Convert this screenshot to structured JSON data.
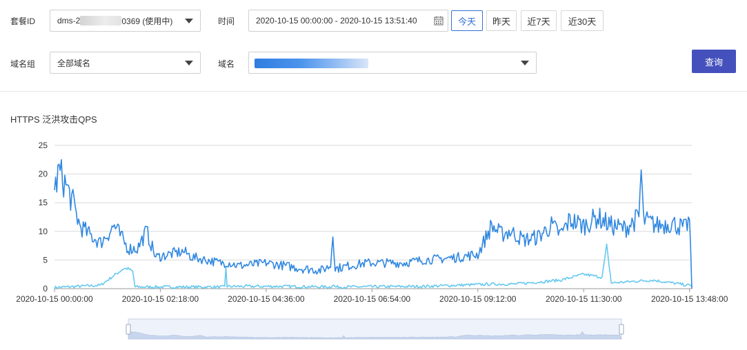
{
  "filters": {
    "package_label": "套餐ID",
    "package_value_prefix": "dms-2",
    "package_value_suffix": "0369 (使用中)",
    "time_label": "时间",
    "time_range": "2020-10-15 00:00:00 - 2020-10-15 13:51:40",
    "quick_buttons": [
      "今天",
      "昨天",
      "近7天",
      "近30天"
    ],
    "active_quick": "今天",
    "domain_group_label": "域名组",
    "domain_group_value": "全部域名",
    "domain_label": "域名",
    "query_button": "查询"
  },
  "colors": {
    "series_primary": "#2f87e0",
    "series_secondary": "#64c8f0",
    "query_button_bg": "#4451bd",
    "active_button": "#2f6fd6"
  },
  "chart_data": {
    "type": "line",
    "title": "HTTPS 泛洪攻击QPS",
    "xlabel": "",
    "ylabel": "",
    "ylim": [
      0,
      25
    ],
    "yticks": [
      0,
      5,
      10,
      15,
      20,
      25
    ],
    "x_ticks": [
      "2020-10-15 00:00:00",
      "2020-10-15 02:18:00",
      "2020-10-15 04:36:00",
      "2020-10-15 06:54:00",
      "2020-10-15 09:12:00",
      "2020-10-15 11:30:00",
      "2020-10-15 13:48:00"
    ],
    "x_unit": "hours since 2020-10-15 00:00:00",
    "grid": "horizontal",
    "series": [
      {
        "x": [
          0,
          0.1,
          0.25,
          0.4,
          0.55,
          0.75,
          1.0,
          1.3,
          1.6,
          1.8,
          2.0,
          2.2,
          2.5,
          2.8,
          3.0,
          3.3,
          3.6,
          3.8,
          4.0,
          4.3,
          4.6,
          5.0,
          5.4,
          5.8,
          6.0,
          6.05,
          6.1,
          6.4,
          6.8,
          7.2,
          7.6,
          8.0,
          8.4,
          8.8,
          9.2,
          9.5,
          9.7,
          9.9,
          10.2,
          10.5,
          10.8,
          11.0,
          11.2,
          11.5,
          11.8,
          12.1,
          12.4,
          12.7,
          12.75,
          12.8,
          13.1,
          13.4,
          13.7,
          13.8,
          13.85
        ],
        "values": [
          17,
          20.5,
          18,
          15,
          11,
          9.5,
          8,
          11,
          7,
          7,
          10,
          5.5,
          6,
          6.5,
          5.5,
          5,
          4.5,
          4.5,
          4,
          4.2,
          4.5,
          4,
          3.5,
          3.2,
          4,
          10,
          3.5,
          4,
          4.5,
          4.5,
          4.5,
          5,
          5.2,
          5.5,
          6,
          11,
          9.5,
          10,
          8.5,
          9,
          11,
          9.5,
          12,
          11,
          12.5,
          11,
          10.5,
          12.5,
          20.5,
          12,
          11,
          11.5,
          10.5,
          12,
          0.3
        ]
      },
      {
        "x": [
          0,
          1.0,
          1.45,
          1.5,
          1.6,
          1.7,
          1.75,
          2.5,
          3.7,
          3.72,
          3.75,
          5.0,
          6.0,
          6.05,
          6.1,
          8.0,
          9.5,
          10.0,
          11.0,
          11.5,
          11.9,
          12.0,
          12.1,
          13.0,
          13.85
        ],
        "values": [
          0.2,
          0.6,
          3.2,
          3.5,
          3.5,
          3.0,
          0.3,
          0.3,
          0.3,
          4.5,
          0.4,
          0.4,
          0.3,
          0.7,
          0.3,
          0.4,
          0.8,
          0.8,
          1.5,
          2.5,
          2.0,
          7.5,
          1.0,
          1.5,
          0.5
        ]
      }
    ]
  }
}
